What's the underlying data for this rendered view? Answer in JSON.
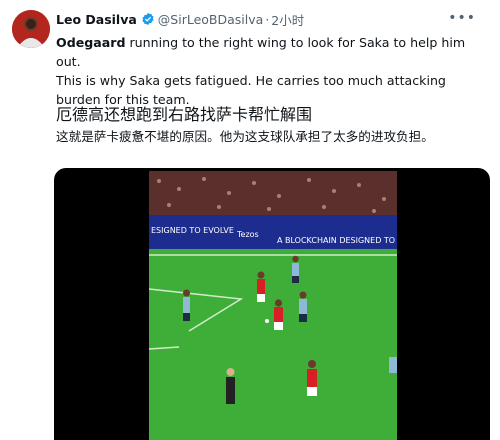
{
  "author": {
    "display_name": "Leo Dasilva",
    "handle": "@SirLeoBDasilva",
    "separator": "·",
    "time": "2小时"
  },
  "icons": {
    "avatar": "user-avatar",
    "verified": "verified-badge-icon",
    "more": "more-options-icon"
  },
  "tweet": {
    "highlight": "Odegaard",
    "line1_rest": " running to the right wing to look for Saka to help him out.",
    "line2": "This is why Saka gets fatigued. He carries too much attacking burden for this team."
  },
  "translation": {
    "title": "厄德高还想跑到右路找萨卡帮忙解围",
    "body": "这就是萨卡疲惫不堪的原因。他为这支球队承担了太多的进攻负担。"
  },
  "media": {
    "board_left": "ESIGNED TO EVOLVE",
    "board_mid": "Tezos",
    "board_right": "A BLOCKCHAIN DESIGNED TO"
  },
  "colors": {
    "verified": "#1d9bf0",
    "pitch": "#3fae38",
    "board": "#1d2c8f",
    "home_kit": "#d81f26",
    "away_kit": "#8fb7d6"
  }
}
